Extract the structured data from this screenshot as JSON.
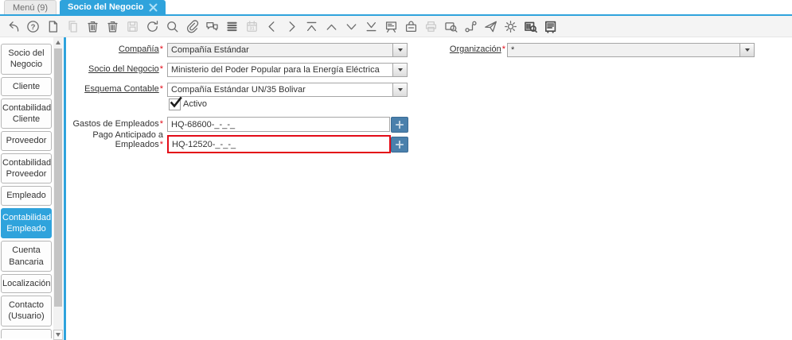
{
  "tabbar": {
    "menu_tab": "Menú (9)",
    "active_tab": "Socio del Negocio"
  },
  "toolbar": {
    "icons": [
      {
        "name": "undo"
      },
      {
        "name": "help",
        "glyph": "?"
      },
      {
        "name": "new-record"
      },
      {
        "name": "copy-record",
        "disabled": true
      },
      {
        "name": "delete-record"
      },
      {
        "name": "delete-selection"
      },
      {
        "name": "save",
        "disabled": true
      },
      {
        "name": "refresh"
      },
      {
        "name": "find"
      },
      {
        "name": "attachment"
      },
      {
        "name": "chat"
      },
      {
        "name": "grid-toggle"
      },
      {
        "name": "calendar",
        "glyph": "31",
        "disabled": true
      },
      {
        "name": "previous-record"
      },
      {
        "name": "next-record"
      },
      {
        "name": "first-record"
      },
      {
        "name": "parent-record"
      },
      {
        "name": "detail-record"
      },
      {
        "name": "last-record"
      },
      {
        "name": "report"
      },
      {
        "name": "archive"
      },
      {
        "name": "print",
        "disabled": true
      },
      {
        "name": "zoom-across"
      },
      {
        "name": "workflow"
      },
      {
        "name": "requests"
      },
      {
        "name": "process"
      },
      {
        "name": "lookup-record"
      },
      {
        "name": "quick-form"
      }
    ]
  },
  "sidebar": {
    "items": [
      {
        "label": "Socio del Negocio"
      },
      {
        "label": "Cliente"
      },
      {
        "label": "Contabilidad Cliente"
      },
      {
        "label": "Proveedor"
      },
      {
        "label": "Contabilidad Proveedor"
      },
      {
        "label": "Empleado"
      },
      {
        "label": "Contabilidad Empleado",
        "selected": true
      },
      {
        "label": "Cuenta Bancaria"
      },
      {
        "label": "Localización"
      },
      {
        "label": "Contacto (Usuario)"
      }
    ]
  },
  "form": {
    "required_mark": "*",
    "compania": {
      "label": "Compañía",
      "value": "Compañía Estándar"
    },
    "organizacion": {
      "label": "Organización",
      "value": "*"
    },
    "socio_negocio": {
      "label": "Socio del Negocio",
      "value": "Ministerio del Poder Popular para la Energía Eléctrica"
    },
    "esquema_contable": {
      "label": "Esquema Contable",
      "value": "Compañía Estándar UN/35 Bolivar"
    },
    "activo": {
      "label": "Activo",
      "checked": true
    },
    "gastos_empleados": {
      "label": "Gastos de Empleados",
      "value": "HQ-68600-_-_-_"
    },
    "pago_anticipado": {
      "label": "Pago Anticipado a Empleados",
      "value": "HQ-12520-_-_-_"
    }
  },
  "colors": {
    "accent": "#2fa3dc",
    "highlight_border": "#e30b17",
    "account_button": "#4a80ac"
  }
}
